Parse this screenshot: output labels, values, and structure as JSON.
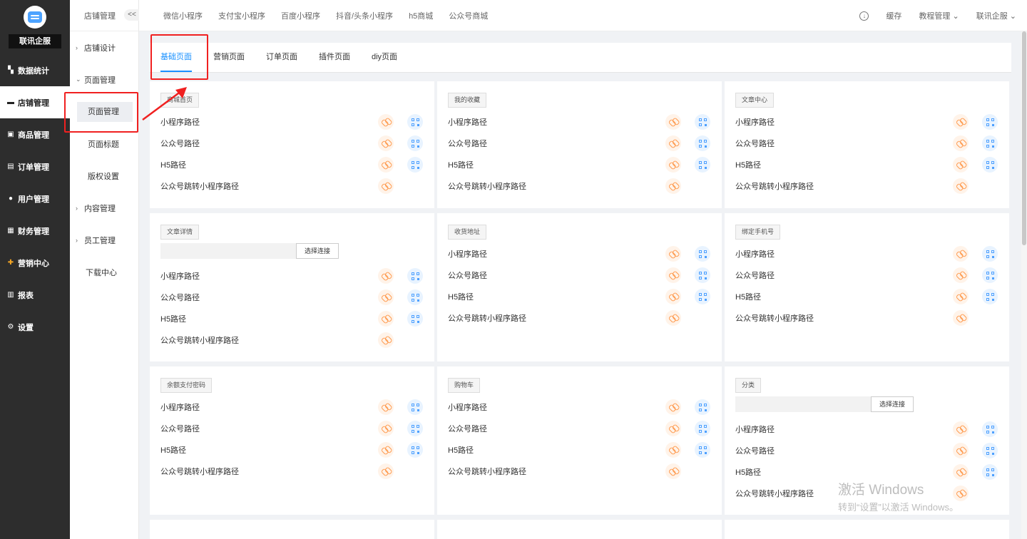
{
  "app": {
    "brand": "联讯企服"
  },
  "sidebar": {
    "items": [
      {
        "label": "数据统计",
        "icon": "chart-icon",
        "glyph": "▚"
      },
      {
        "label": "店铺管理",
        "icon": "store-icon",
        "glyph": "▬",
        "active": true
      },
      {
        "label": "商品管理",
        "icon": "goods-icon",
        "glyph": "▣"
      },
      {
        "label": "订单管理",
        "icon": "order-icon",
        "glyph": "▤"
      },
      {
        "label": "用户管理",
        "icon": "user-icon",
        "glyph": "●"
      },
      {
        "label": "财务管理",
        "icon": "finance-icon",
        "glyph": "▦"
      },
      {
        "label": "营销中心",
        "icon": "marketing-icon",
        "glyph": "✚"
      },
      {
        "label": "报表",
        "icon": "report-icon",
        "glyph": "▥"
      },
      {
        "label": "设置",
        "icon": "settings-icon",
        "glyph": "⚙"
      }
    ]
  },
  "submenu": {
    "title": "店铺管理",
    "collapse": "<<",
    "entries": [
      {
        "type": "group",
        "label": "店铺设计",
        "chevron": "›"
      },
      {
        "type": "group",
        "label": "页面管理",
        "chevron": "⌄"
      },
      {
        "type": "child",
        "label": "页面管理",
        "active": true
      },
      {
        "type": "child",
        "label": "页面标题"
      },
      {
        "type": "child",
        "label": "版权设置"
      },
      {
        "type": "group",
        "label": "内容管理",
        "chevron": "›"
      },
      {
        "type": "group",
        "label": "员工管理",
        "chevron": "›"
      },
      {
        "type": "child-flat",
        "label": "下载中心"
      }
    ]
  },
  "topbar": {
    "tabs": [
      "微信小程序",
      "支付宝小程序",
      "百度小程序",
      "抖音/头条小程序",
      "h5商城",
      "公众号商城"
    ],
    "cache": "缓存",
    "tutorial": "教程管理",
    "user": "联讯企服"
  },
  "page_tabs": {
    "tabs": [
      "基础页面",
      "营销页面",
      "订单页面",
      "插件页面",
      "diy页面"
    ],
    "active": 0
  },
  "link_labels": {
    "mini": "小程序路径",
    "mp": "公众号路径",
    "h5": "H5路径",
    "mp_to_mini": "公众号跳转小程序路径",
    "select_link": "选择连接"
  },
  "cards": [
    {
      "title": "商城首页"
    },
    {
      "title": "我的收藏"
    },
    {
      "title": "文章中心"
    },
    {
      "title": "文章详情",
      "has_selector": true
    },
    {
      "title": "收货地址"
    },
    {
      "title": "绑定手机号"
    },
    {
      "title": "余额支付密码"
    },
    {
      "title": "购物车"
    },
    {
      "title": "分类",
      "has_selector": true
    }
  ],
  "watermark": {
    "line1": "激活 Windows",
    "line2": "转到“设置”以激活 Windows。"
  },
  "colors": {
    "accent": "#1890ff",
    "sidebar_bg": "#2d2d2d",
    "link_icon": "#ff9a4d",
    "qr_icon": "#4da0ff",
    "annotation": "#f02020"
  }
}
